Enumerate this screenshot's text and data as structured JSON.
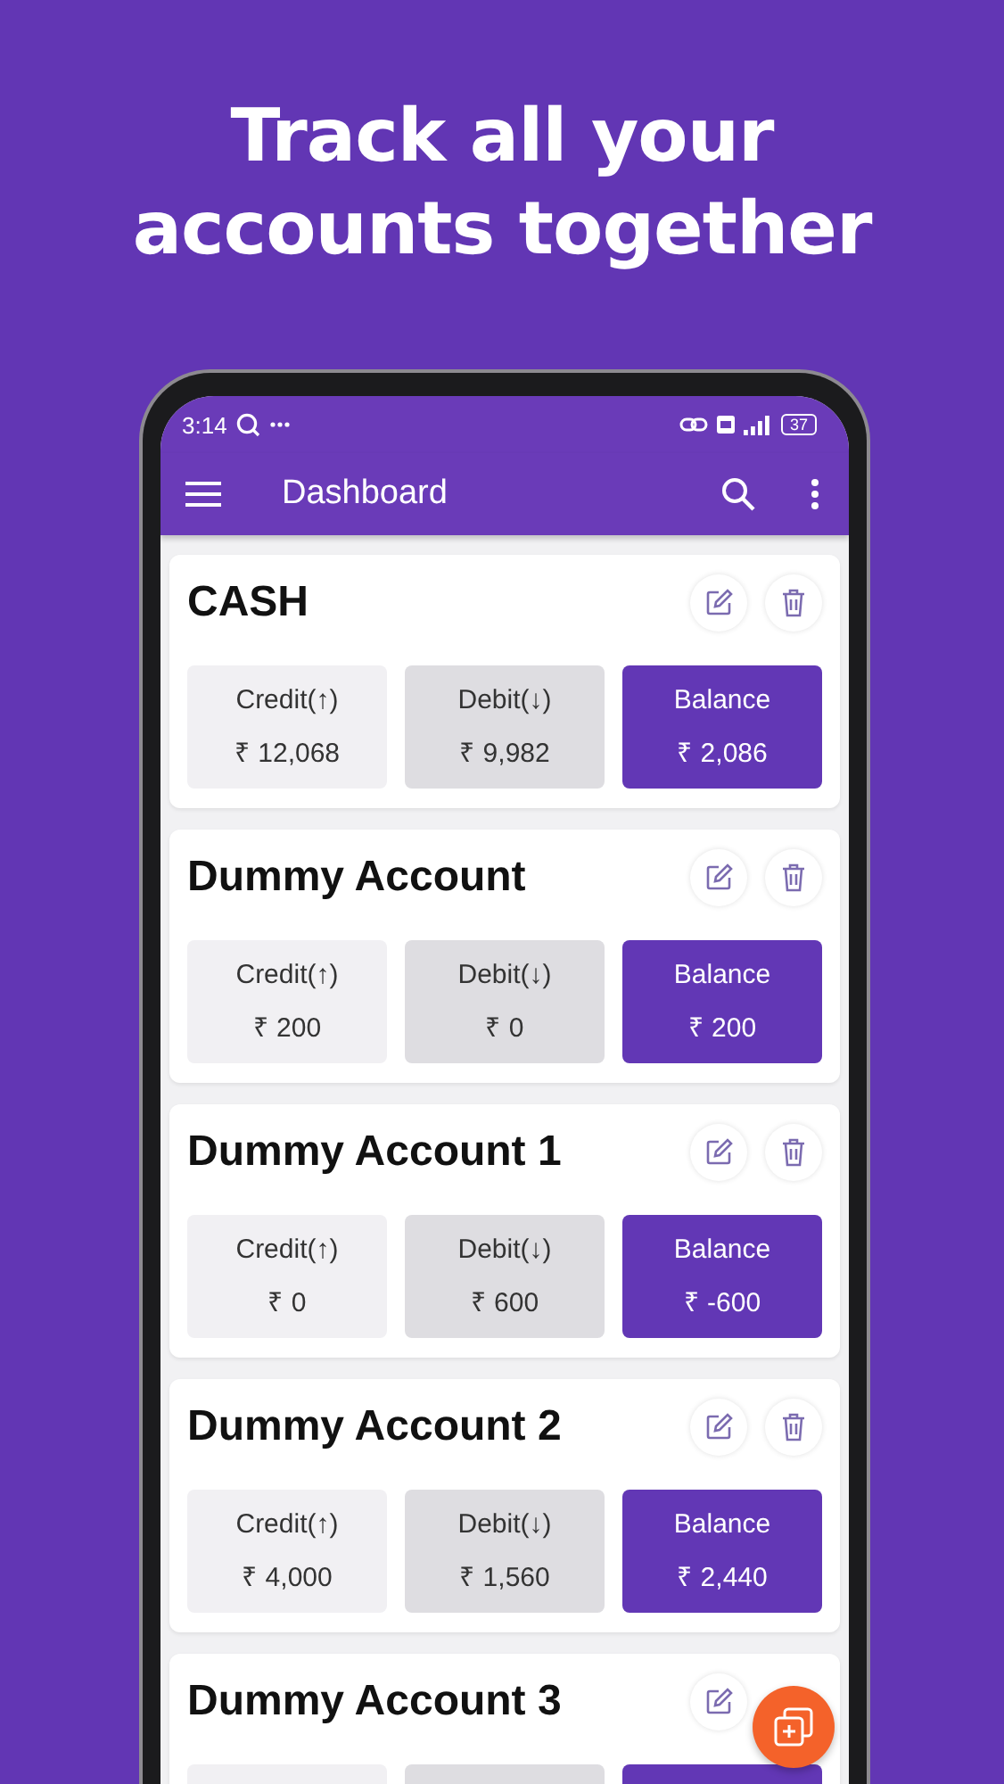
{
  "headline": "Track all your accounts together",
  "status_bar": {
    "time": "3:14",
    "battery": "37"
  },
  "app_bar": {
    "title": "Dashboard"
  },
  "accounts": [
    {
      "name": "CASH",
      "delete_button": true,
      "stats": [
        {
          "kind": "credit",
          "label": "Credit(↑)",
          "value": "₹ 12,068"
        },
        {
          "kind": "debit",
          "label": "Debit(↓)",
          "value": "₹ 9,982"
        },
        {
          "kind": "balance",
          "label": "Balance",
          "value": "₹ 2,086"
        }
      ]
    },
    {
      "name": "Dummy Account",
      "delete_button": true,
      "stats": [
        {
          "kind": "credit",
          "label": "Credit(↑)",
          "value": "₹ 200"
        },
        {
          "kind": "debit",
          "label": "Debit(↓)",
          "value": "₹ 0"
        },
        {
          "kind": "balance",
          "label": "Balance",
          "value": "₹ 200"
        }
      ]
    },
    {
      "name": "Dummy Account 1",
      "delete_button": true,
      "stats": [
        {
          "kind": "credit",
          "label": "Credit(↑)",
          "value": "₹ 0"
        },
        {
          "kind": "debit",
          "label": "Debit(↓)",
          "value": "₹ 600"
        },
        {
          "kind": "balance",
          "label": "Balance",
          "value": "₹ -600"
        }
      ]
    },
    {
      "name": "Dummy Account 2",
      "delete_button": true,
      "stats": [
        {
          "kind": "credit",
          "label": "Credit(↑)",
          "value": "₹ 4,000"
        },
        {
          "kind": "debit",
          "label": "Debit(↓)",
          "value": "₹ 1,560"
        },
        {
          "kind": "balance",
          "label": "Balance",
          "value": "₹ 2,440"
        }
      ]
    },
    {
      "name": "Dummy Account 3",
      "delete_button": false,
      "stats": [
        {
          "kind": "credit"
        },
        {
          "kind": "debit"
        },
        {
          "kind": "balance"
        }
      ]
    }
  ]
}
